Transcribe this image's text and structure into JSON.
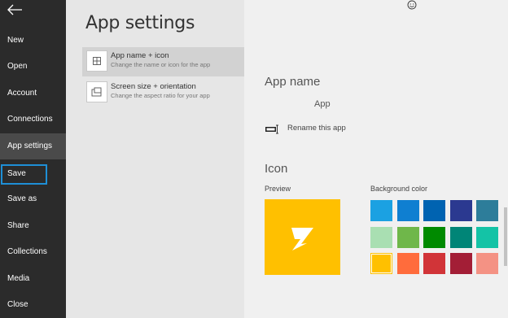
{
  "nav": {
    "items": [
      {
        "label": "New"
      },
      {
        "label": "Open"
      },
      {
        "label": "Account"
      },
      {
        "label": "Connections"
      },
      {
        "label": "App settings"
      },
      {
        "label": "Save"
      },
      {
        "label": "Save as"
      },
      {
        "label": "Share"
      },
      {
        "label": "Collections"
      },
      {
        "label": "Media"
      },
      {
        "label": "Close"
      }
    ],
    "active": "App settings",
    "highlighted": "Save"
  },
  "settings": {
    "title": "App settings",
    "options": [
      {
        "title": "App name + icon",
        "subtitle": "Change the name or icon for the app",
        "icon": "app-grid-icon",
        "selected": true
      },
      {
        "title": "Screen size + orientation",
        "subtitle": "Change the aspect ratio for your app",
        "icon": "screen-orientation-icon",
        "selected": false
      }
    ]
  },
  "app_name": {
    "heading": "App name",
    "value": "App",
    "rename_label": "Rename this app"
  },
  "icon_section": {
    "heading": "Icon",
    "preview_label": "Preview",
    "background_label": "Background color",
    "preview_color": "#ffc000",
    "preview_icon": "lightning-icon",
    "colors": [
      [
        "#1ba1e2",
        "#0f7fd1",
        "#0063b1",
        "#2b3990",
        "#2d7d9a"
      ],
      [
        "#a9dfb2",
        "#6fb74a",
        "#008a00",
        "#008577",
        "#14c3a6"
      ],
      [
        "#ffc000",
        "#ff6c3c",
        "#d13438",
        "#a31e36",
        "#f49284"
      ]
    ],
    "selected_color": "#ffc000"
  }
}
